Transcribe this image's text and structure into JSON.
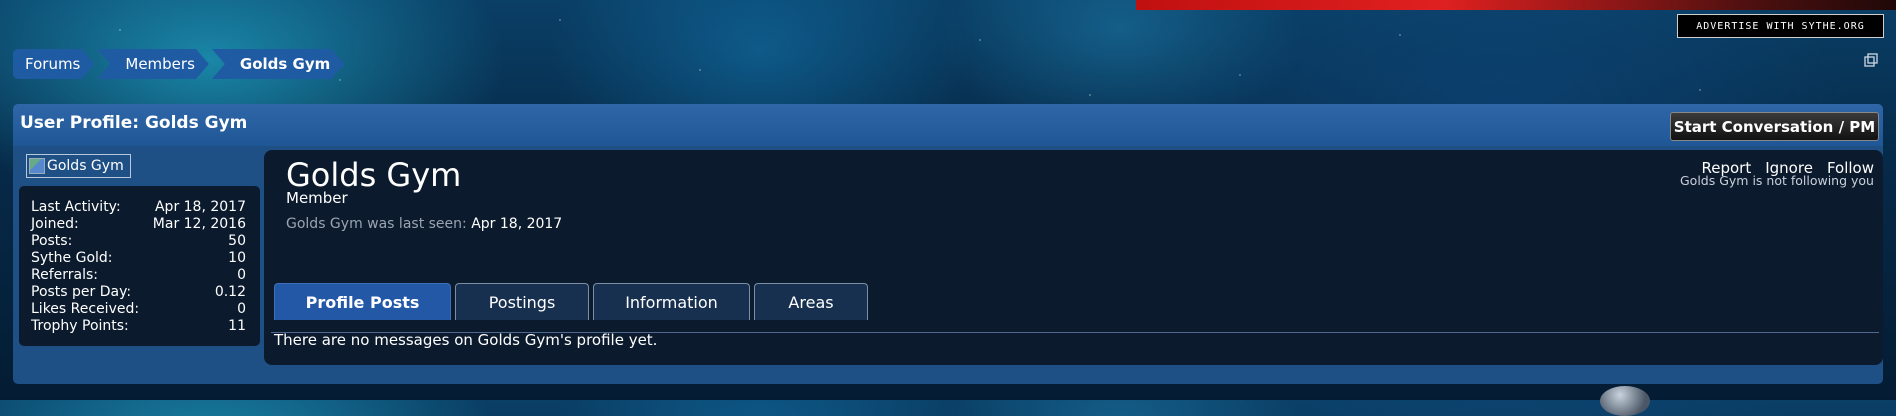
{
  "banner": {
    "advertise_label": "Advertise with Sythe.org"
  },
  "breadcrumb": [
    "Forums",
    "Members",
    "Golds Gym"
  ],
  "header": {
    "title": "User Profile: Golds Gym",
    "pm_button": "Start Conversation / PM"
  },
  "sidebar": {
    "avatar_alt": "Golds Gym",
    "stats": [
      {
        "label": "Last Activity:",
        "value": "Apr 18, 2017"
      },
      {
        "label": "Joined:",
        "value": "Mar 12, 2016"
      },
      {
        "label": "Posts:",
        "value": "50"
      },
      {
        "label": "Sythe Gold:",
        "value": "10"
      },
      {
        "label": "Referrals:",
        "value": "0"
      },
      {
        "label": "Posts per Day:",
        "value": "0.12"
      },
      {
        "label": "Likes Received:",
        "value": "0"
      },
      {
        "label": "Trophy Points:",
        "value": "11"
      }
    ]
  },
  "profile": {
    "username": "Golds Gym",
    "user_title": "Member",
    "last_seen_text": "Golds Gym was last seen:",
    "last_seen_date": "Apr 18, 2017",
    "actions": {
      "report": "Report",
      "ignore": "Ignore",
      "follow": "Follow"
    },
    "follow_status": "Golds Gym is not following you"
  },
  "tabs": [
    {
      "label": "Profile Posts",
      "active": true
    },
    {
      "label": "Postings"
    },
    {
      "label": "Information"
    },
    {
      "label": "Areas"
    }
  ],
  "tab_content": {
    "message": "There are no messages on Golds Gym's profile yet."
  },
  "colors": {
    "accent": "#1f5ba3",
    "panel": "#0b1a2d",
    "active_tab": "#2358a6"
  }
}
